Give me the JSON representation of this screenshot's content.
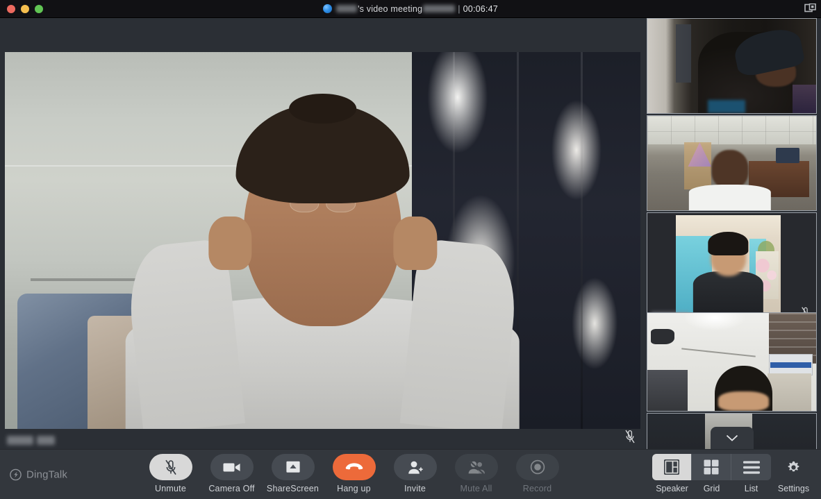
{
  "window": {
    "title_prefix_redacted": true,
    "title_text": "'s video meeting",
    "separator": "|",
    "timer": "00:06:47",
    "traffic_lights": [
      "close",
      "minimize",
      "zoom"
    ],
    "expand_icon": "expand-icon",
    "colors": {
      "titlebar_bg": "#111114",
      "app_bg": "#2b2f35",
      "toolbar_bg": "#33373d",
      "accent_danger": "#ed6a3a",
      "active_light": "#d8d8d8",
      "label_text": "#cfd2d6",
      "disabled_text": "#70757c"
    }
  },
  "stage": {
    "active_speaker_name_redacted": true,
    "active_speaker_muted": true,
    "mic_icon": "mic-muted-icon"
  },
  "sidebar": {
    "participants": [
      {
        "index": 1,
        "name_redacted": false,
        "muted": false,
        "scene": "dark-corridor"
      },
      {
        "index": 2,
        "name_redacted": false,
        "muted": false,
        "scene": "room-white-shirt"
      },
      {
        "index": 3,
        "name_redacted": true,
        "muted": true,
        "scene": "blue-curtain-room"
      },
      {
        "index": 4,
        "name_redacted": false,
        "muted": false,
        "scene": "bright-white-room"
      },
      {
        "index": 5,
        "name_redacted": false,
        "muted": false,
        "scene": "partial"
      }
    ],
    "scroll_down_icon": "chevron-down-icon"
  },
  "toolbar": {
    "brand": "DingTalk",
    "brand_icon": "dingtalk-logo-icon",
    "buttons": [
      {
        "id": "unmute",
        "label": "Unmute",
        "icon": "mic-muted-icon",
        "state": "active-light",
        "disabled": false
      },
      {
        "id": "camera",
        "label": "Camera Off",
        "icon": "video-camera-icon",
        "state": "normal",
        "disabled": false
      },
      {
        "id": "sharescreen",
        "label": "ShareScreen",
        "icon": "share-screen-icon",
        "state": "normal",
        "disabled": false
      },
      {
        "id": "hangup",
        "label": "Hang up",
        "icon": "phone-hangup-icon",
        "state": "danger",
        "disabled": false
      },
      {
        "id": "invite",
        "label": "Invite",
        "icon": "add-person-icon",
        "state": "normal",
        "disabled": false
      },
      {
        "id": "muteall",
        "label": "Mute All",
        "icon": "mute-all-icon",
        "state": "disabled",
        "disabled": true
      },
      {
        "id": "record",
        "label": "Record",
        "icon": "record-icon",
        "state": "disabled",
        "disabled": true
      }
    ],
    "views": [
      {
        "id": "speaker",
        "label": "Speaker",
        "icon": "speaker-layout-icon",
        "active": true
      },
      {
        "id": "grid",
        "label": "Grid",
        "icon": "grid-layout-icon",
        "active": false
      },
      {
        "id": "list",
        "label": "List",
        "icon": "list-layout-icon",
        "active": false
      }
    ],
    "settings": {
      "label": "Settings",
      "icon": "gear-icon"
    }
  }
}
